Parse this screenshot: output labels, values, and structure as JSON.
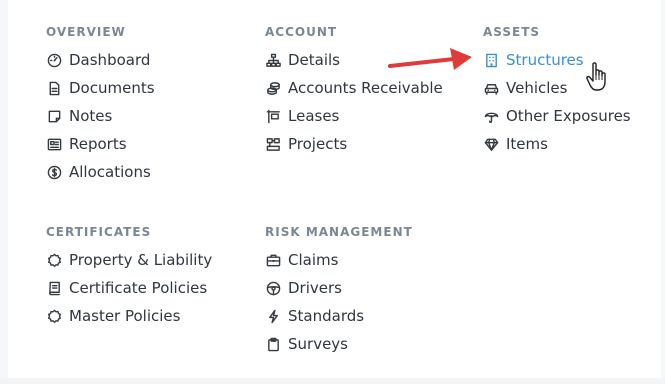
{
  "columns": [
    {
      "title": "OVERVIEW",
      "items": [
        {
          "label": "Dashboard",
          "icon": "dashboard-icon"
        },
        {
          "label": "Documents",
          "icon": "document-icon"
        },
        {
          "label": "Notes",
          "icon": "note-icon"
        },
        {
          "label": "Reports",
          "icon": "reports-icon"
        },
        {
          "label": "Allocations",
          "icon": "dollar-circle-icon"
        }
      ]
    },
    {
      "title": "ACCOUNT",
      "items": [
        {
          "label": "Details",
          "icon": "sitemap-icon"
        },
        {
          "label": "Accounts Receivable",
          "icon": "coins-icon"
        },
        {
          "label": "Leases",
          "icon": "sign-icon"
        },
        {
          "label": "Projects",
          "icon": "tasks-icon"
        }
      ]
    },
    {
      "title": "ASSETS",
      "items": [
        {
          "label": "Structures",
          "icon": "building-icon",
          "active": true
        },
        {
          "label": "Vehicles",
          "icon": "car-icon"
        },
        {
          "label": "Other Exposures",
          "icon": "umbrella-icon"
        },
        {
          "label": "Items",
          "icon": "gem-icon"
        }
      ]
    },
    {
      "title": "CERTIFICATES",
      "items": [
        {
          "label": "Property & Liability",
          "icon": "certificate-icon"
        },
        {
          "label": "Certificate Policies",
          "icon": "policy-book-icon"
        },
        {
          "label": "Master Policies",
          "icon": "certificate-icon"
        }
      ]
    },
    {
      "title": "RISK MANAGEMENT",
      "items": [
        {
          "label": "Claims",
          "icon": "briefcase-icon"
        },
        {
          "label": "Drivers",
          "icon": "steering-wheel-icon"
        },
        {
          "label": "Standards",
          "icon": "bolt-icon"
        },
        {
          "label": "Surveys",
          "icon": "clipboard-icon"
        }
      ]
    }
  ],
  "colors": {
    "section_title": "#7b8794",
    "item_text": "#2f3640",
    "active_text": "#3a8fd2",
    "annotation_arrow": "#e03b3b"
  }
}
